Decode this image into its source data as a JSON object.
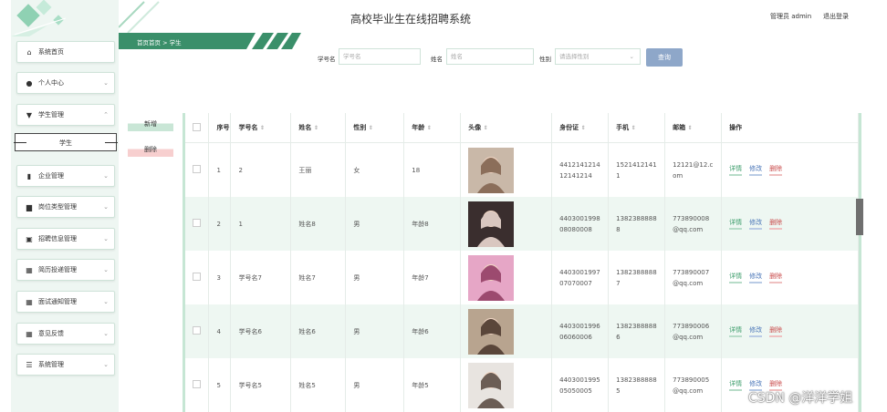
{
  "header": {
    "app_title": "高校毕业生在线招聘系统",
    "admin_text": "管理员 admin",
    "logout": "退出登录"
  },
  "breadcrumb": "首页首页 > 学生",
  "sidebar": {
    "items": [
      {
        "label": "系统首页",
        "icon": "home-icon",
        "chevron": ""
      },
      {
        "label": "个人中心",
        "icon": "user-icon",
        "chevron": "⌄"
      },
      {
        "label": "学生管理",
        "icon": "cup-icon",
        "chevron": "⌃"
      },
      {
        "label": "企业管理",
        "icon": "chart-icon",
        "chevron": "⌄"
      },
      {
        "label": "岗位类型管理",
        "icon": "book-icon",
        "chevron": "⌄"
      },
      {
        "label": "招聘信息管理",
        "icon": "clipboard-icon",
        "chevron": "⌄"
      },
      {
        "label": "简历投递管理",
        "icon": "grid-icon",
        "chevron": "⌄"
      },
      {
        "label": "面试通知管理",
        "icon": "grid-icon",
        "chevron": "⌄"
      },
      {
        "label": "意见反馈",
        "icon": "grid-icon",
        "chevron": "⌄"
      },
      {
        "label": "系统管理",
        "icon": "sliders-icon",
        "chevron": "⌄"
      }
    ],
    "sub_item": "学生"
  },
  "search": {
    "student_no_label": "学号名",
    "student_no_placeholder": "学号名",
    "name_label": "姓名",
    "name_placeholder": "姓名",
    "gender_label": "性别",
    "gender_placeholder": "请选择性别",
    "query_button": "查询"
  },
  "actions": {
    "add": "新增",
    "delete": "删除"
  },
  "table": {
    "headers": [
      "",
      "序号",
      "学号名",
      "姓名",
      "性别",
      "年龄",
      "头像",
      "身份证",
      "手机",
      "邮箱",
      "操作"
    ],
    "rows": [
      {
        "idx": "1",
        "sid": "2",
        "name": "王丽",
        "gender": "女",
        "age": "18",
        "idcard": "4412141214\n12141214",
        "phone": "1521412141\n1",
        "email": "12121@12.c\nom"
      },
      {
        "idx": "2",
        "sid": "1",
        "name": "姓名8",
        "gender": "男",
        "age": "年龄8",
        "idcard": "4403001998\n08080008",
        "phone": "1382388888\n8",
        "email": "773890008\n@qq.com"
      },
      {
        "idx": "3",
        "sid": "学号名7",
        "name": "姓名7",
        "gender": "男",
        "age": "年龄7",
        "idcard": "4403001997\n07070007",
        "phone": "1382388888\n7",
        "email": "773890007\n@qq.com"
      },
      {
        "idx": "4",
        "sid": "学号名6",
        "name": "姓名6",
        "gender": "男",
        "age": "年龄6",
        "idcard": "4403001996\n06060006",
        "phone": "1382388888\n6",
        "email": "773890006\n@qq.com"
      },
      {
        "idx": "5",
        "sid": "学号名5",
        "name": "姓名5",
        "gender": "男",
        "age": "年龄5",
        "idcard": "4403001995\n05050005",
        "phone": "1382388888\n5",
        "email": "773890005\n@qq.com"
      }
    ],
    "ops": {
      "detail": "详情",
      "edit": "修改",
      "delete": "删除"
    }
  },
  "watermark": "CSDN @洋洋学姐",
  "colors": {
    "accent": "#2e9e72",
    "sidebar_bg": "#eef6f2",
    "row_alt": "#eef7f2",
    "query_btn": "#8ea7c9"
  }
}
